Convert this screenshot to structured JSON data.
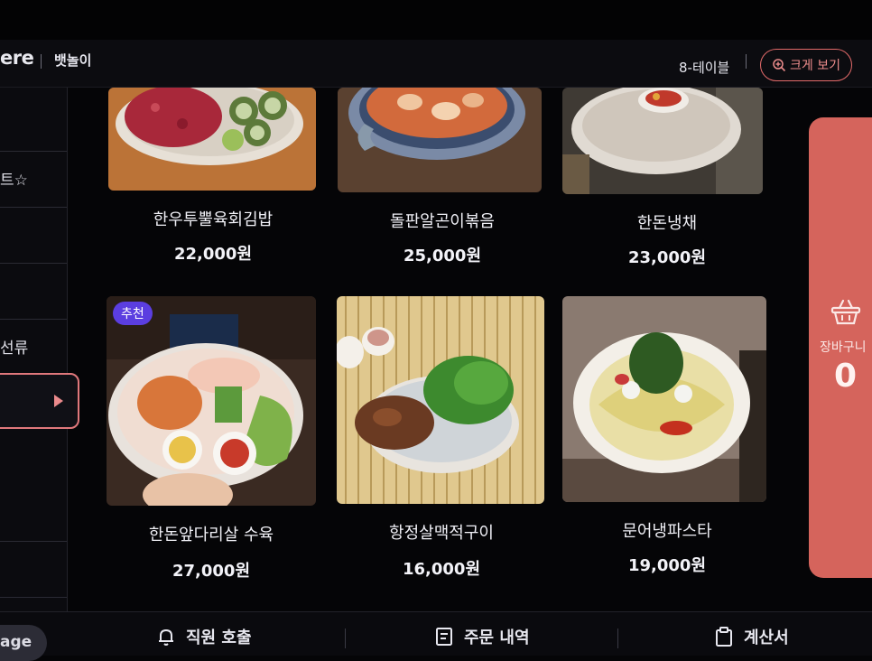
{
  "header": {
    "brand": "ere",
    "store_name": "뱃놀이",
    "table_name": "8-테이블",
    "zoom_label": "크게 보기"
  },
  "sidebar": {
    "items": [
      {
        "label": "트☆"
      },
      {
        "label": ""
      },
      {
        "label": "선류"
      },
      {
        "label": "",
        "active": true
      }
    ]
  },
  "menu": {
    "items": [
      {
        "name": "한우투뿔육회김밥",
        "price": "22,000원"
      },
      {
        "name": "돌판알곤이볶음",
        "price": "25,000원"
      },
      {
        "name": "한돈냉채",
        "price": "23,000원"
      },
      {
        "name": "한돈앞다리살 수육",
        "price": "27,000원",
        "badge": "추천"
      },
      {
        "name": "항정살맥적구이",
        "price": "16,000원"
      },
      {
        "name": "문어냉파스타",
        "price": "19,000원"
      }
    ]
  },
  "cart": {
    "label": "장바구니",
    "count": "0"
  },
  "bottom": {
    "page_label": "age",
    "call_staff": "직원 호출",
    "order_history": "주문 내역",
    "bill": "계산서"
  },
  "colors": {
    "accent": "#e36a6a",
    "cart_bg": "#d5645c",
    "badge_bg": "#5b3ee0"
  },
  "icons": [
    "zoom-in-icon",
    "basket-icon",
    "bell-icon",
    "receipt-icon",
    "clipboard-icon"
  ]
}
